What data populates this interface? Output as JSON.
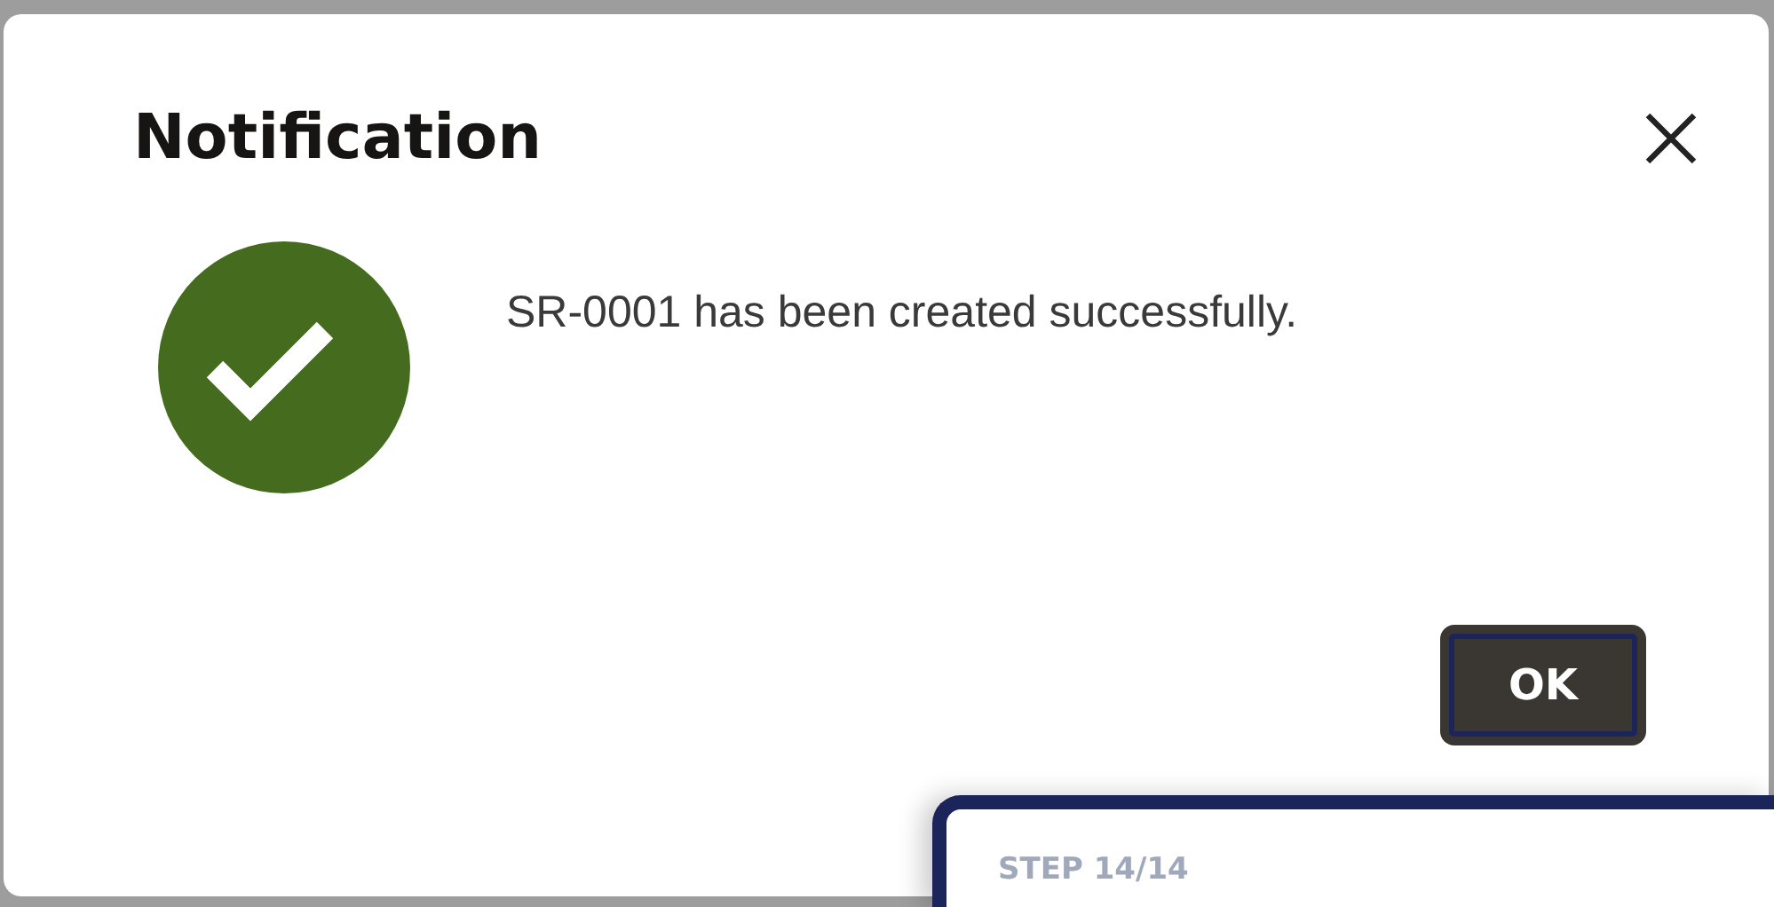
{
  "dialog": {
    "title": "Notification",
    "kind": "success",
    "message": "SR-0001 has been created successfully.",
    "buttons": [
      {
        "label": "OK",
        "focused": true
      }
    ]
  },
  "tour_popup": {
    "step": "STEP 14/14"
  }
}
